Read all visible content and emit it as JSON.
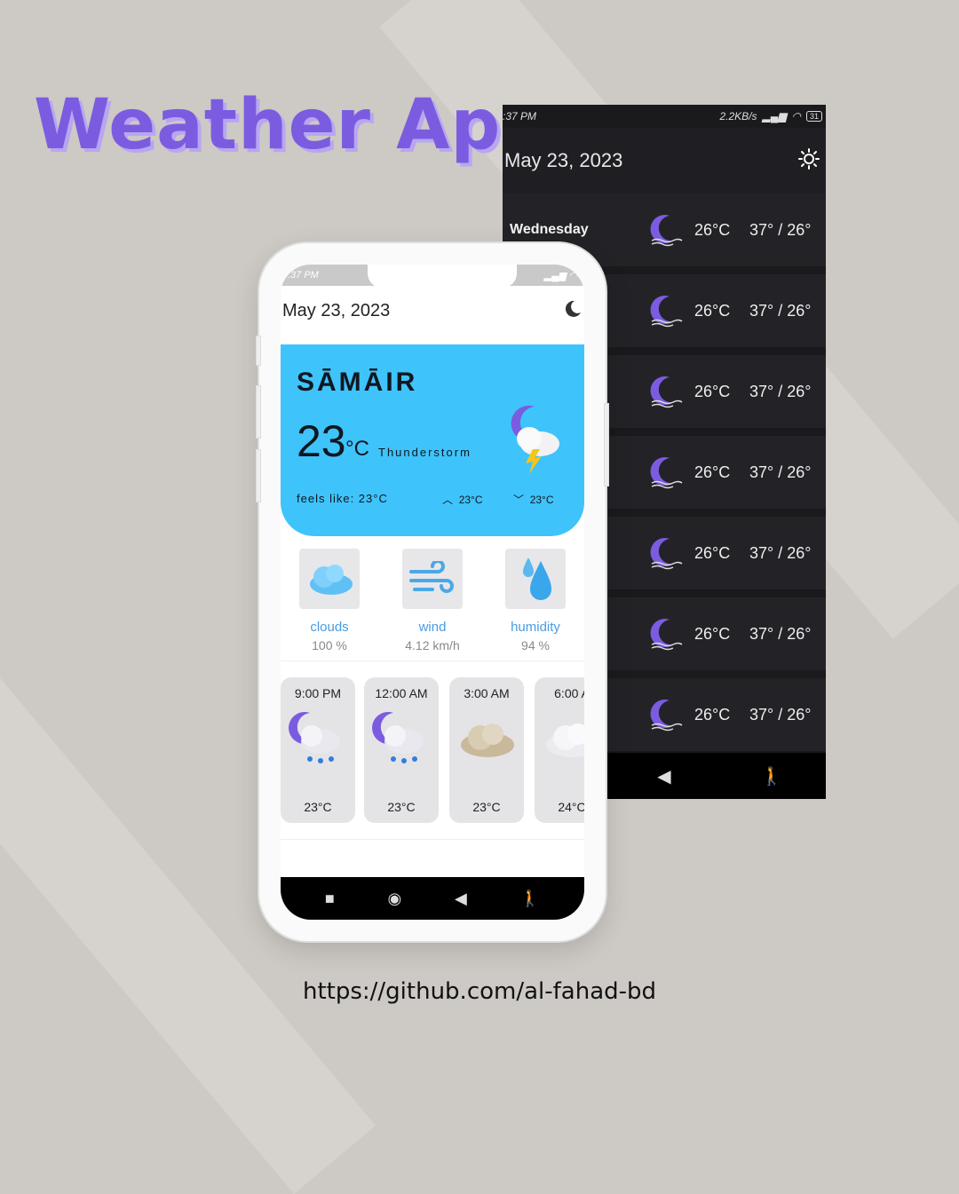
{
  "title": "Weather App",
  "footer_link": "https://github.com/al-fahad-bd",
  "colors": {
    "accent": "#7b5ce0",
    "card": "#3fc3fb",
    "dark_bg": "#1a1a1d"
  },
  "dark_screen": {
    "status_time": ":37 PM",
    "status_speed": "2.2KB/s",
    "battery": "31",
    "date": "May 23, 2023",
    "theme_icon": "sun-icon",
    "days": [
      {
        "name": "Wednesday",
        "temp": "26°C",
        "range": "37° / 26°"
      },
      {
        "name": "",
        "temp": "26°C",
        "range": "37° / 26°"
      },
      {
        "name": "",
        "temp": "26°C",
        "range": "37° / 26°"
      },
      {
        "name": "",
        "temp": "26°C",
        "range": "37° / 26°"
      },
      {
        "name": "",
        "temp": "26°C",
        "range": "37° / 26°"
      },
      {
        "name": "",
        "temp": "26°C",
        "range": "37° / 26°"
      },
      {
        "name": "",
        "temp": "26°C",
        "range": "37° / 26°"
      }
    ],
    "nav": [
      "◉",
      "◀",
      "🚶"
    ]
  },
  "light_screen": {
    "status_time": ":37 PM",
    "date": "May 23, 2023",
    "theme_icon": "moon-icon",
    "city": "SĀMĀIR",
    "temp": "23",
    "unit": "°C",
    "condition": "Thunderstorm",
    "feels_like": "feels like: 23°C",
    "high": "23°C",
    "low": "23°C",
    "stats": [
      {
        "label": "clouds",
        "value": "100 %"
      },
      {
        "label": "wind",
        "value": "4.12 km/h"
      },
      {
        "label": "humidity",
        "value": "94 %"
      }
    ],
    "hourly": [
      {
        "time": "9:00 PM",
        "temp": "23°C"
      },
      {
        "time": "12:00 AM",
        "temp": "23°C"
      },
      {
        "time": "3:00 AM",
        "temp": "23°C"
      },
      {
        "time": "6:00 A",
        "temp": "24°C"
      }
    ]
  }
}
